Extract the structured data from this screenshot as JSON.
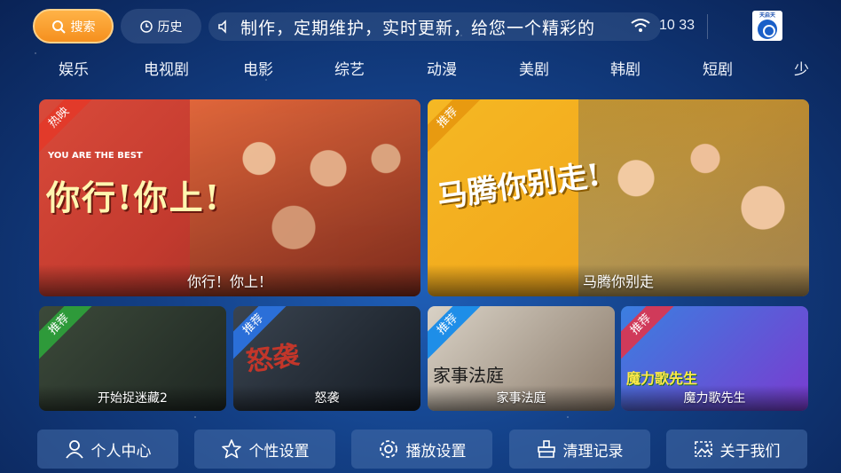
{
  "header": {
    "search_label": "搜索",
    "history_label": "历史",
    "marquee_text": "制作，定期维护，实时更新，给您一个精彩的",
    "clock": "10 33",
    "logo_text": "天启天"
  },
  "nav": {
    "items": [
      "娱乐",
      "电视剧",
      "电影",
      "综艺",
      "动漫",
      "美剧",
      "韩剧",
      "短剧",
      "少"
    ]
  },
  "cards": {
    "featured": [
      {
        "title": "你行！你上！",
        "badge": "热映",
        "badge_color": "#e23a2a",
        "poster_title": "你行!你上!",
        "poster_en": "YOU ARE THE BEST"
      },
      {
        "title": "马腾你别走",
        "badge": "推荐",
        "badge_color": "#e89a10",
        "poster_title": "马腾你别走!"
      }
    ],
    "small": [
      {
        "title": "开始捉迷藏2",
        "badge": "推荐",
        "badge_color": "#2e9a3a"
      },
      {
        "title": "怒袭",
        "badge": "推荐",
        "badge_color": "#2b6fd8",
        "poster_art": "怒袭"
      },
      {
        "title": "家事法庭",
        "badge": "推荐",
        "badge_color": "#1e8ee8",
        "poster_art": "家事法庭"
      },
      {
        "title": "魔力歌先生",
        "badge": "推荐",
        "badge_color": "#d03a5a",
        "poster_art": "魔力歌先生"
      }
    ]
  },
  "bottom": {
    "personal_center": "个人中心",
    "personal_settings": "个性设置",
    "playback_settings": "播放设置",
    "clear_records": "清理记录",
    "about_us": "关于我们"
  }
}
